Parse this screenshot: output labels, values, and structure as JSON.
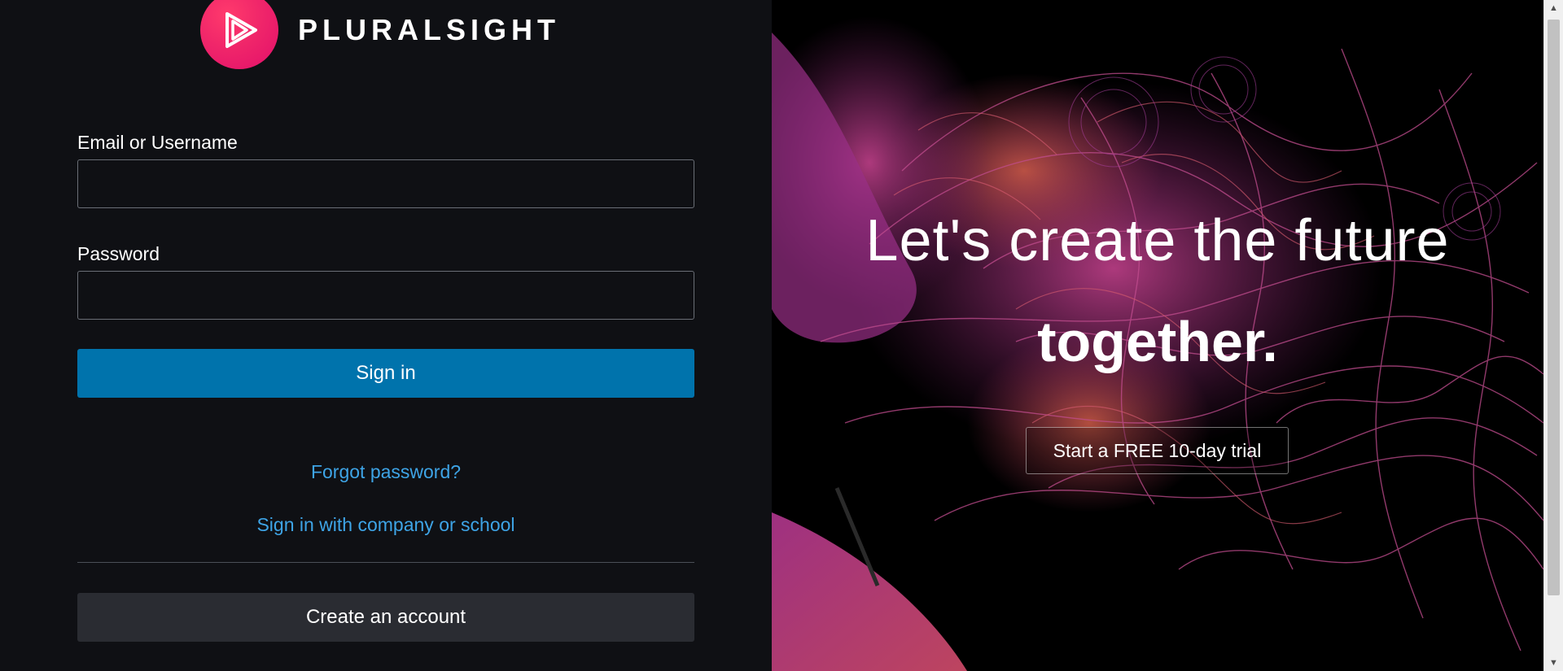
{
  "brand": {
    "name": "PLURALSIGHT",
    "accent": "#f0266a"
  },
  "login": {
    "email_label": "Email or Username",
    "email_value": "",
    "password_label": "Password",
    "password_value": "",
    "signin_label": "Sign in",
    "forgot_label": "Forgot password?",
    "company_label": "Sign in with company or school",
    "create_label": "Create an account",
    "primary_color": "#0073ac",
    "link_color": "#3ea4e6"
  },
  "promo": {
    "headline_line1": "Let's create the future",
    "headline_line2": "together",
    "headline_dot": ".",
    "trial_label": "Start a FREE 10-day trial"
  },
  "icons": {
    "logo": "play-triangles-icon",
    "scroll_up": "chevron-up-icon",
    "scroll_down": "chevron-down-icon"
  }
}
